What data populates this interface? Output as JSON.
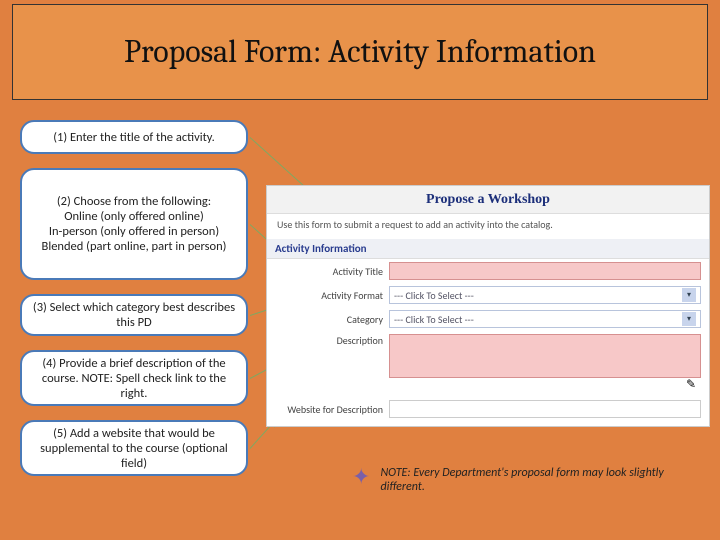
{
  "title": "Proposal Form: Activity Information",
  "callouts": {
    "c1": "(1) Enter the title of the activity.",
    "c2": "(2) Choose from the following:\nOnline (only offered online)\nIn-person (only offered in person)\nBlended (part online, part in person)",
    "c3": "(3) Select which category best describes this PD",
    "c4": "(4) Provide a brief description of the course.  NOTE: Spell check link to the right.",
    "c5": "(5) Add a website that would be supplemental to the course (optional field)"
  },
  "form": {
    "header": "Propose a Workshop",
    "sub": "Use this form to submit a request to add an activity into the catalog.",
    "section": "Activity Information",
    "labels": {
      "title": "Activity Title",
      "format": "Activity Format",
      "category": "Category",
      "description": "Description",
      "website": "Website for Description"
    },
    "select_placeholder": "--- Click To Select ---"
  },
  "note": "NOTE: Every Department's proposal form may look slightly different."
}
